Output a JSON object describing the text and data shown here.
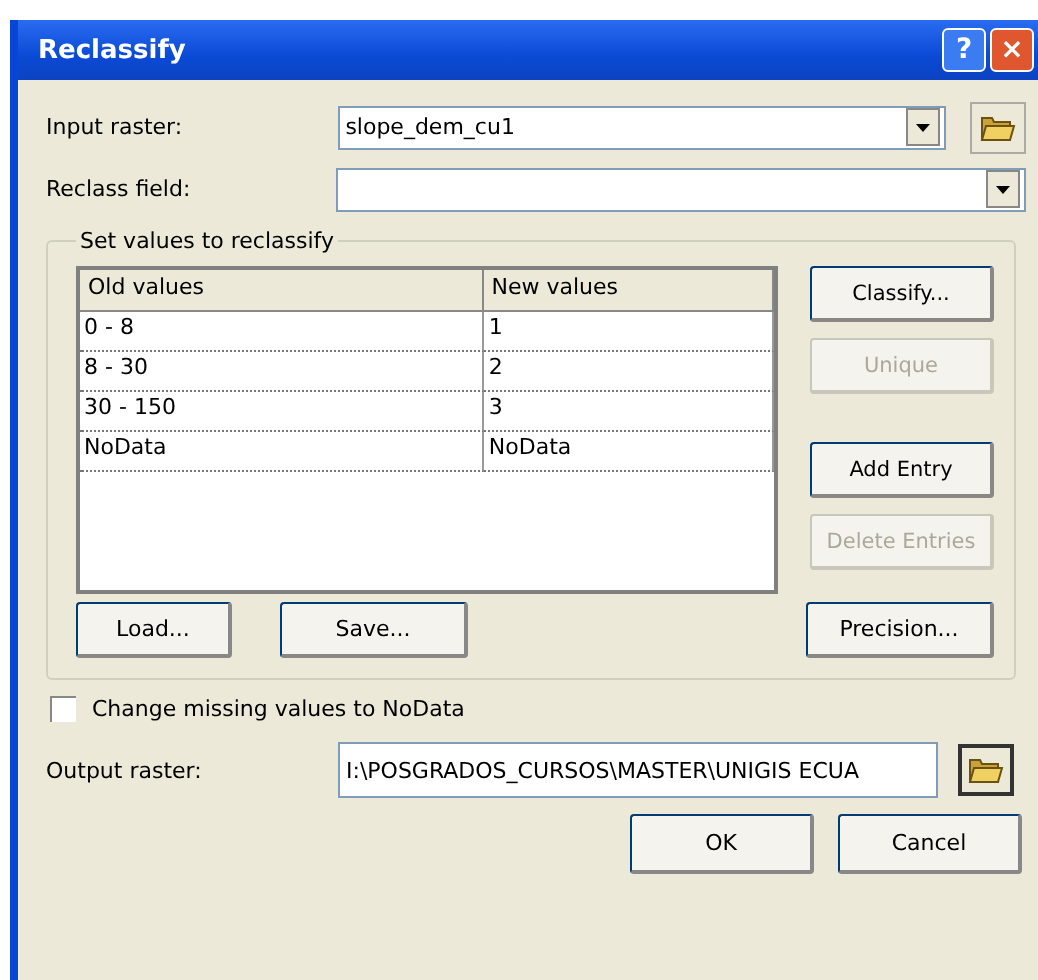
{
  "window": {
    "title": "Reclassify",
    "title_buttons": [
      "?",
      "×"
    ]
  },
  "input_raster": {
    "label": "Input raster:",
    "value": "slope_dem_cu1"
  },
  "reclass_field": {
    "label": "Reclass field:"
  },
  "group": {
    "title": "Set values to reclassify",
    "table": {
      "columns": [
        "Old values",
        "New values"
      ],
      "rows": [
        [
          "0 - 8",
          "1"
        ],
        [
          "8 - 30",
          "2"
        ],
        [
          "30 - 150",
          "3"
        ],
        [
          "NoData",
          "NoData"
        ]
      ]
    },
    "side_buttons_top": [
      {
        "label": "Classify...",
        "disabled": false
      },
      {
        "label": "Unique",
        "disabled": true
      }
    ],
    "side_buttons_bottom": [
      {
        "label": "Add Entry",
        "disabled": false
      },
      {
        "label": "Delete Entries",
        "disabled": true
      }
    ],
    "bottom_buttons": [
      {
        "label": "Load...",
        "disabled": false
      },
      {
        "label": "Save...",
        "disabled": false
      }
    ],
    "precision_button": {
      "label": "Precision...",
      "disabled": false
    }
  },
  "missing_to_nodata": {
    "label": "Change missing values to NoData",
    "checked": false
  },
  "output_raster": {
    "label": "Output raster:",
    "value": "I:\\POSGRADOS_CURSOS\\MASTER\\UNIGIS ECUA"
  },
  "buttons": [
    "OK",
    "Cancel"
  ]
}
